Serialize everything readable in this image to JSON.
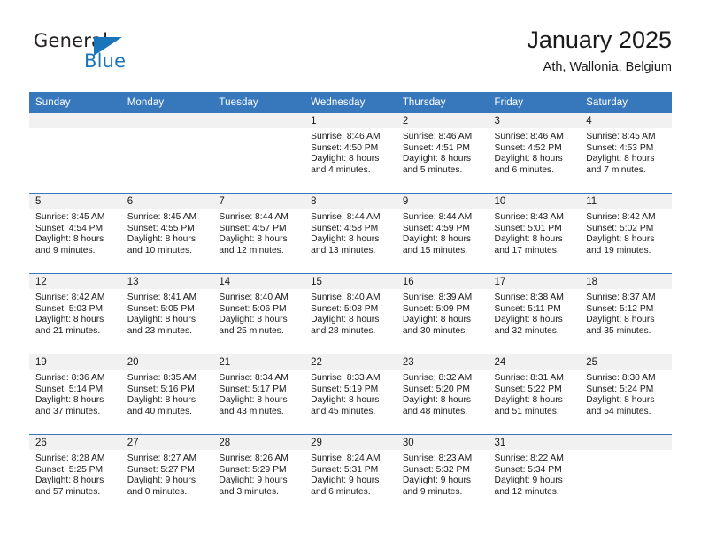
{
  "logo": {
    "word_one": "General",
    "word_two": "Blue",
    "triangle_color": "#1b75bb",
    "text_color": "#231f20"
  },
  "header": {
    "title": "January 2025",
    "subtitle": "Ath, Wallonia, Belgium"
  },
  "theme": {
    "header_blue": "#3778bc",
    "daynum_band": "#f1f1f1",
    "text": "#1a1a1a"
  },
  "weekday_headers": [
    "Sunday",
    "Monday",
    "Tuesday",
    "Wednesday",
    "Thursday",
    "Friday",
    "Saturday"
  ],
  "weeks": [
    [
      {
        "day": "",
        "empty": true
      },
      {
        "day": "",
        "empty": true
      },
      {
        "day": "",
        "empty": true
      },
      {
        "day": "1",
        "sunrise": "Sunrise: 8:46 AM",
        "sunset": "Sunset: 4:50 PM",
        "daylight": "Daylight: 8 hours and 4 minutes."
      },
      {
        "day": "2",
        "sunrise": "Sunrise: 8:46 AM",
        "sunset": "Sunset: 4:51 PM",
        "daylight": "Daylight: 8 hours and 5 minutes."
      },
      {
        "day": "3",
        "sunrise": "Sunrise: 8:46 AM",
        "sunset": "Sunset: 4:52 PM",
        "daylight": "Daylight: 8 hours and 6 minutes."
      },
      {
        "day": "4",
        "sunrise": "Sunrise: 8:45 AM",
        "sunset": "Sunset: 4:53 PM",
        "daylight": "Daylight: 8 hours and 7 minutes."
      }
    ],
    [
      {
        "day": "5",
        "sunrise": "Sunrise: 8:45 AM",
        "sunset": "Sunset: 4:54 PM",
        "daylight": "Daylight: 8 hours and 9 minutes."
      },
      {
        "day": "6",
        "sunrise": "Sunrise: 8:45 AM",
        "sunset": "Sunset: 4:55 PM",
        "daylight": "Daylight: 8 hours and 10 minutes."
      },
      {
        "day": "7",
        "sunrise": "Sunrise: 8:44 AM",
        "sunset": "Sunset: 4:57 PM",
        "daylight": "Daylight: 8 hours and 12 minutes."
      },
      {
        "day": "8",
        "sunrise": "Sunrise: 8:44 AM",
        "sunset": "Sunset: 4:58 PM",
        "daylight": "Daylight: 8 hours and 13 minutes."
      },
      {
        "day": "9",
        "sunrise": "Sunrise: 8:44 AM",
        "sunset": "Sunset: 4:59 PM",
        "daylight": "Daylight: 8 hours and 15 minutes."
      },
      {
        "day": "10",
        "sunrise": "Sunrise: 8:43 AM",
        "sunset": "Sunset: 5:01 PM",
        "daylight": "Daylight: 8 hours and 17 minutes."
      },
      {
        "day": "11",
        "sunrise": "Sunrise: 8:42 AM",
        "sunset": "Sunset: 5:02 PM",
        "daylight": "Daylight: 8 hours and 19 minutes."
      }
    ],
    [
      {
        "day": "12",
        "sunrise": "Sunrise: 8:42 AM",
        "sunset": "Sunset: 5:03 PM",
        "daylight": "Daylight: 8 hours and 21 minutes."
      },
      {
        "day": "13",
        "sunrise": "Sunrise: 8:41 AM",
        "sunset": "Sunset: 5:05 PM",
        "daylight": "Daylight: 8 hours and 23 minutes."
      },
      {
        "day": "14",
        "sunrise": "Sunrise: 8:40 AM",
        "sunset": "Sunset: 5:06 PM",
        "daylight": "Daylight: 8 hours and 25 minutes."
      },
      {
        "day": "15",
        "sunrise": "Sunrise: 8:40 AM",
        "sunset": "Sunset: 5:08 PM",
        "daylight": "Daylight: 8 hours and 28 minutes."
      },
      {
        "day": "16",
        "sunrise": "Sunrise: 8:39 AM",
        "sunset": "Sunset: 5:09 PM",
        "daylight": "Daylight: 8 hours and 30 minutes."
      },
      {
        "day": "17",
        "sunrise": "Sunrise: 8:38 AM",
        "sunset": "Sunset: 5:11 PM",
        "daylight": "Daylight: 8 hours and 32 minutes."
      },
      {
        "day": "18",
        "sunrise": "Sunrise: 8:37 AM",
        "sunset": "Sunset: 5:12 PM",
        "daylight": "Daylight: 8 hours and 35 minutes."
      }
    ],
    [
      {
        "day": "19",
        "sunrise": "Sunrise: 8:36 AM",
        "sunset": "Sunset: 5:14 PM",
        "daylight": "Daylight: 8 hours and 37 minutes."
      },
      {
        "day": "20",
        "sunrise": "Sunrise: 8:35 AM",
        "sunset": "Sunset: 5:16 PM",
        "daylight": "Daylight: 8 hours and 40 minutes."
      },
      {
        "day": "21",
        "sunrise": "Sunrise: 8:34 AM",
        "sunset": "Sunset: 5:17 PM",
        "daylight": "Daylight: 8 hours and 43 minutes."
      },
      {
        "day": "22",
        "sunrise": "Sunrise: 8:33 AM",
        "sunset": "Sunset: 5:19 PM",
        "daylight": "Daylight: 8 hours and 45 minutes."
      },
      {
        "day": "23",
        "sunrise": "Sunrise: 8:32 AM",
        "sunset": "Sunset: 5:20 PM",
        "daylight": "Daylight: 8 hours and 48 minutes."
      },
      {
        "day": "24",
        "sunrise": "Sunrise: 8:31 AM",
        "sunset": "Sunset: 5:22 PM",
        "daylight": "Daylight: 8 hours and 51 minutes."
      },
      {
        "day": "25",
        "sunrise": "Sunrise: 8:30 AM",
        "sunset": "Sunset: 5:24 PM",
        "daylight": "Daylight: 8 hours and 54 minutes."
      }
    ],
    [
      {
        "day": "26",
        "sunrise": "Sunrise: 8:28 AM",
        "sunset": "Sunset: 5:25 PM",
        "daylight": "Daylight: 8 hours and 57 minutes."
      },
      {
        "day": "27",
        "sunrise": "Sunrise: 8:27 AM",
        "sunset": "Sunset: 5:27 PM",
        "daylight": "Daylight: 9 hours and 0 minutes."
      },
      {
        "day": "28",
        "sunrise": "Sunrise: 8:26 AM",
        "sunset": "Sunset: 5:29 PM",
        "daylight": "Daylight: 9 hours and 3 minutes."
      },
      {
        "day": "29",
        "sunrise": "Sunrise: 8:24 AM",
        "sunset": "Sunset: 5:31 PM",
        "daylight": "Daylight: 9 hours and 6 minutes."
      },
      {
        "day": "30",
        "sunrise": "Sunrise: 8:23 AM",
        "sunset": "Sunset: 5:32 PM",
        "daylight": "Daylight: 9 hours and 9 minutes."
      },
      {
        "day": "31",
        "sunrise": "Sunrise: 8:22 AM",
        "sunset": "Sunset: 5:34 PM",
        "daylight": "Daylight: 9 hours and 12 minutes."
      },
      {
        "day": "",
        "empty": true
      }
    ]
  ]
}
